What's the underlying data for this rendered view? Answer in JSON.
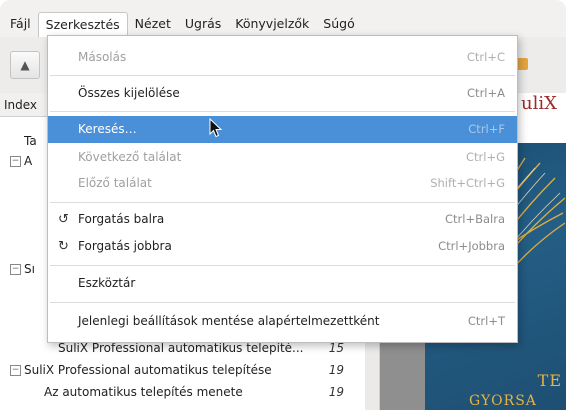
{
  "menubar": {
    "items": [
      {
        "label": "Fájl"
      },
      {
        "label": "Szerkesztés"
      },
      {
        "label": "Nézet"
      },
      {
        "label": "Ugrás"
      },
      {
        "label": "Könyvjelzők"
      },
      {
        "label": "Súgó"
      }
    ]
  },
  "sidebar": {
    "header": "Index",
    "rows": [
      {
        "label": "Ta",
        "page": ""
      },
      {
        "label": "A",
        "page": ""
      },
      {
        "label": "Sı",
        "page": ""
      },
      {
        "label": "SuliX Professional automatikus telepíté...",
        "page": "15"
      },
      {
        "label": "SuliX Professional automatikus telepítése",
        "page": "19"
      },
      {
        "label": "Az automatikus telepítés menete",
        "page": "19"
      }
    ]
  },
  "document": {
    "brand": "uliX",
    "cover_text_1": "TE",
    "cover_text_2": "GYORSA"
  },
  "edit_menu": {
    "items": [
      {
        "label": "Másolás",
        "shortcut": "Ctrl+C",
        "enabled": false
      },
      {
        "label": "Összes kijelölése",
        "shortcut": "Ctrl+A",
        "enabled": true
      },
      {
        "label": "Keresés…",
        "shortcut": "Ctrl+F",
        "enabled": true,
        "highlighted": true
      },
      {
        "label": "Következő találat",
        "shortcut": "Ctrl+G",
        "enabled": false
      },
      {
        "label": "Előző találat",
        "shortcut": "Shift+Ctrl+G",
        "enabled": false
      },
      {
        "label": "Forgatás balra",
        "shortcut": "Ctrl+Balra",
        "enabled": true,
        "icon": "rotate-left-icon"
      },
      {
        "label": "Forgatás jobbra",
        "shortcut": "Ctrl+Jobbra",
        "enabled": true,
        "icon": "rotate-right-icon"
      },
      {
        "label": "Eszköztár",
        "shortcut": "",
        "enabled": true
      },
      {
        "label": "Jelenlegi beállítások mentése alapértelmezettként",
        "shortcut": "Ctrl+T",
        "enabled": true
      }
    ]
  },
  "colors": {
    "highlight": "#4a90d9",
    "brand_red": "#9a2a2a",
    "cover_blue": "#245e86",
    "cover_gold": "#e6b340"
  }
}
